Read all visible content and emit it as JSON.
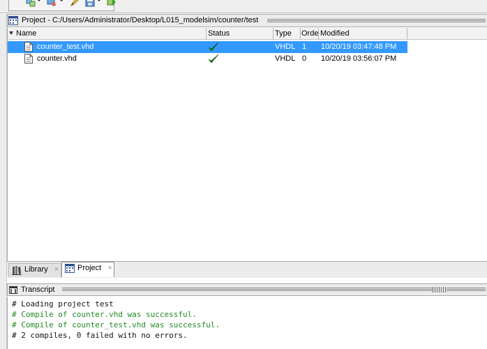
{
  "toolbar": {
    "buttons": [
      {
        "icon": "compile-icon",
        "has_dropdown": true
      },
      {
        "icon": "simulate-icon",
        "has_dropdown": true
      },
      {
        "icon": "edit-icon",
        "has_dropdown": false
      },
      {
        "icon": "save-icon",
        "has_dropdown": true
      },
      {
        "icon": "run-icon",
        "has_dropdown": false
      }
    ]
  },
  "project": {
    "title": "Project - C:/Users/Administrator/Desktop/L015_modelsim/counter/test",
    "columns": [
      "Name",
      "Status",
      "Type",
      "Order",
      "Modified"
    ],
    "files": [
      {
        "name": "counter_test.vhd",
        "status": "compiled",
        "type": "VHDL",
        "order": "1",
        "modified": "10/20/19 03:47:48 PM",
        "selected": true
      },
      {
        "name": "counter.vhd",
        "status": "compiled",
        "type": "VHDL",
        "order": "0",
        "modified": "10/20/19 03:56:07 PM",
        "selected": false
      }
    ]
  },
  "tabs": {
    "library": "Library",
    "project": "Project",
    "close_glyph": "×",
    "active": "Project"
  },
  "transcript": {
    "title": "Transcript",
    "lines": [
      {
        "text": "# Loading project test",
        "kind": "info"
      },
      {
        "text": "# Compile of counter.vhd was successful.",
        "kind": "ok"
      },
      {
        "text": "# Compile of counter_test.vhd was successful.",
        "kind": "ok"
      },
      {
        "text": "# 2 compiles, 0 failed with no errors.",
        "kind": "info"
      }
    ]
  },
  "colors": {
    "selection": "#3399ff",
    "success_text": "#1f8a22",
    "checkmark": "#1a7a1a"
  }
}
